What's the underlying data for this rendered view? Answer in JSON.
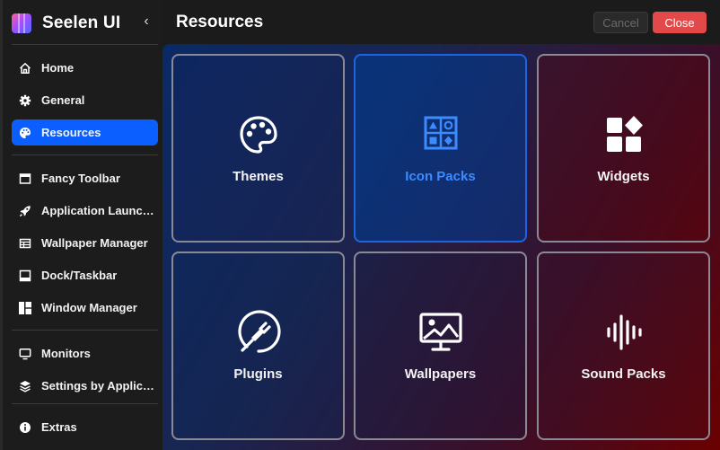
{
  "app": {
    "title": "Seelen UI",
    "collapse_glyph": "‹"
  },
  "header": {
    "title": "Resources",
    "cancel_label": "Cancel",
    "close_label": "Close"
  },
  "sidebar": {
    "items": [
      {
        "label": "Home",
        "icon": "home-icon"
      },
      {
        "label": "General",
        "icon": "gear-icon"
      },
      {
        "label": "Resources",
        "icon": "palette-icon",
        "active": true
      },
      {
        "label": "Fancy Toolbar",
        "icon": "toolbar-icon"
      },
      {
        "label": "Application Launcher",
        "icon": "rocket-icon"
      },
      {
        "label": "Wallpaper Manager",
        "icon": "wallpaper-icon"
      },
      {
        "label": "Dock/Taskbar",
        "icon": "dock-icon"
      },
      {
        "label": "Window Manager",
        "icon": "window-layout-icon"
      },
      {
        "label": "Monitors",
        "icon": "monitor-icon"
      },
      {
        "label": "Settings by Applica...",
        "icon": "layers-icon"
      },
      {
        "label": "Extras",
        "icon": "info-icon"
      }
    ]
  },
  "resources": {
    "cards": [
      {
        "label": "Themes",
        "icon": "palette-icon"
      },
      {
        "label": "Icon Packs",
        "icon": "icon-pack-icon",
        "selected": true
      },
      {
        "label": "Widgets",
        "icon": "widgets-icon"
      },
      {
        "label": "Plugins",
        "icon": "plug-icon"
      },
      {
        "label": "Wallpapers",
        "icon": "wallpaper-monitor-icon"
      },
      {
        "label": "Sound Packs",
        "icon": "sound-wave-icon"
      }
    ]
  },
  "colors": {
    "accent": "#0b5fff",
    "close": "#e34949",
    "selected_label": "#3d8bff"
  }
}
